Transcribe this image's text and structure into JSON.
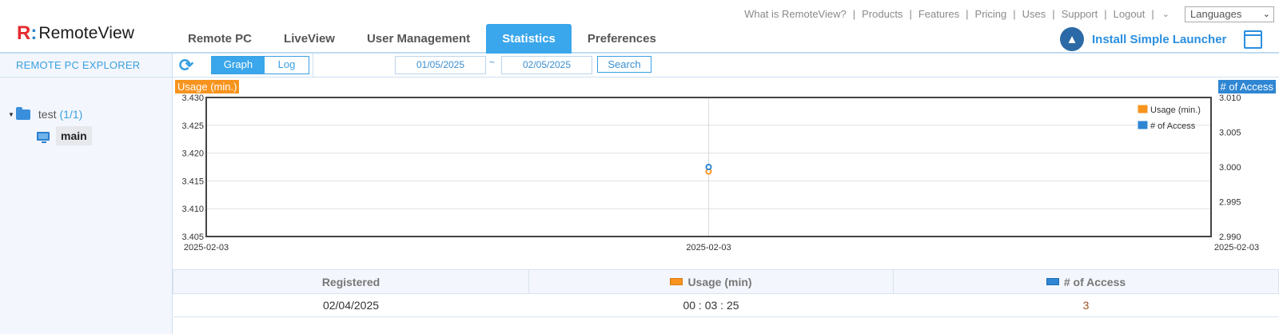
{
  "brand": {
    "mark": "R",
    "mark_colon": ":",
    "word": "RemoteView"
  },
  "top_links": [
    "What is RemoteView?",
    "Products",
    "Features",
    "Pricing",
    "Uses",
    "Support",
    "Logout"
  ],
  "language_select": "Languages",
  "main_nav": [
    "Remote PC",
    "LiveView",
    "User Management",
    "Statistics",
    "Preferences"
  ],
  "active_tab": "Statistics",
  "launcher_label": "Install Simple Launcher",
  "sidebar": {
    "title": "REMOTE PC EXPLORER",
    "group_name": "test",
    "group_count": "(1/1)",
    "pc_name": "main"
  },
  "toolbar": {
    "view_graph": "Graph",
    "view_log": "Log",
    "date_from": "01/05/2025",
    "date_sep": "~",
    "date_to": "02/05/2025",
    "search_label": "Search"
  },
  "chart_data": {
    "type": "line",
    "x": [
      "2025-02-03"
    ],
    "x_tick_labels": [
      "2025-02-03",
      "2025-02-03",
      "2025-02-03"
    ],
    "left_axis": {
      "label": "Usage (min.)",
      "ylim": [
        3.405,
        3.43
      ],
      "ticks": [
        "3.430",
        "3.425",
        "3.420",
        "3.415",
        "3.410",
        "3.405"
      ]
    },
    "right_axis": {
      "label": "# of Access",
      "ylim": [
        2.99,
        3.01
      ],
      "ticks": [
        "3.010",
        "3.005",
        "3.000",
        "2.995",
        "2.990"
      ]
    },
    "series": [
      {
        "name": "Usage (min.)",
        "axis": "left",
        "values": [
          3.4167
        ],
        "color": "#f7941e"
      },
      {
        "name": "# of Access",
        "axis": "right",
        "values": [
          3.0
        ],
        "color": "#2f86d3"
      }
    ],
    "legend_position": "top-right",
    "grid": true
  },
  "table": {
    "headers": [
      "Registered",
      "Usage (min)",
      "# of Access"
    ],
    "rows": [
      {
        "registered": "02/04/2025",
        "usage": "00 : 03 : 25",
        "access": "3"
      }
    ]
  },
  "colors": {
    "accent": "#3aa6ec",
    "usage": "#f7941e",
    "access": "#2f86d3"
  }
}
